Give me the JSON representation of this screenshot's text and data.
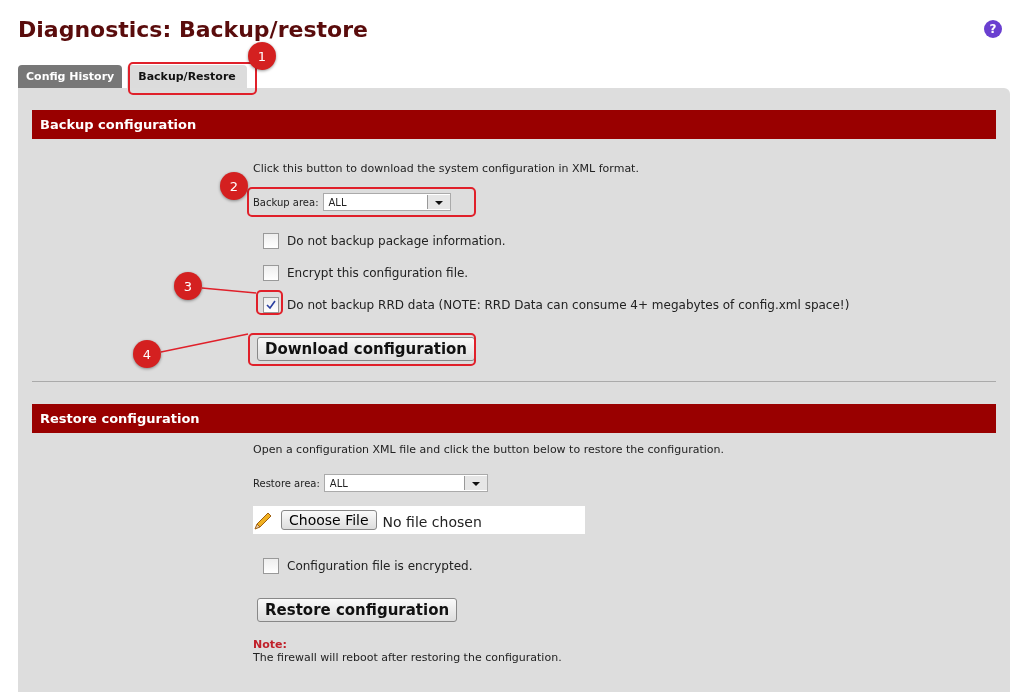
{
  "page": {
    "title": "Diagnostics: Backup/restore",
    "help": "?"
  },
  "tabs": [
    {
      "label": "Config History",
      "selected": false
    },
    {
      "label": "Backup/Restore",
      "selected": true
    }
  ],
  "sections": [
    {
      "title": "Backup configuration",
      "intro": "Click this button to download the system configuration in XML format.",
      "area": {
        "label": "Backup area:",
        "value": "ALL"
      },
      "options": [
        {
          "label": "Do not backup package information.",
          "checked": false
        },
        {
          "label": "Encrypt this configuration file.",
          "checked": false
        },
        {
          "label": "Do not backup RRD data (NOTE: RRD Data can consume 4+ megabytes of config.xml space!)",
          "checked": true
        }
      ],
      "button": "Download configuration"
    },
    {
      "title": "Restore configuration",
      "intro": "Open a configuration XML file and click the button below to restore the configuration.",
      "area": {
        "label": "Restore area:",
        "value": "ALL"
      },
      "file": {
        "button": "Choose File",
        "status": "No file chosen"
      },
      "options": [
        {
          "label": "Configuration file is encrypted.",
          "checked": false
        }
      ],
      "button": "Restore configuration",
      "note": {
        "label": "Note:",
        "text": "The firewall will reboot after restoring the configuration."
      }
    }
  ],
  "callouts": [
    {
      "label": "1"
    },
    {
      "label": "2"
    },
    {
      "label": "3"
    },
    {
      "label": "4"
    }
  ]
}
